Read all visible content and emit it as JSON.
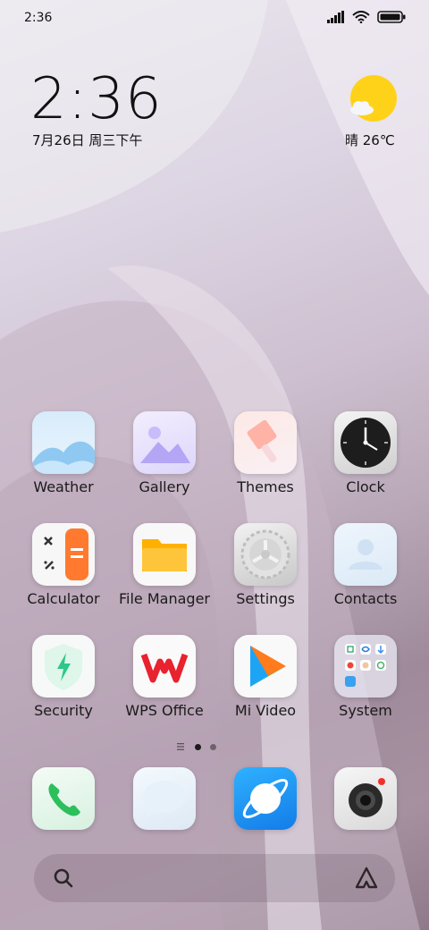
{
  "status_bar": {
    "time": "2:36"
  },
  "clock_widget": {
    "time": "2:36",
    "date": "7月26日 周三下午"
  },
  "weather_widget": {
    "condition_temp": "晴 26℃"
  },
  "apps": [
    {
      "label": "Weather"
    },
    {
      "label": "Gallery"
    },
    {
      "label": "Themes"
    },
    {
      "label": "Clock"
    },
    {
      "label": "Calculator"
    },
    {
      "label": "File Manager"
    },
    {
      "label": "Settings"
    },
    {
      "label": "Contacts"
    },
    {
      "label": "Security"
    },
    {
      "label": "WPS Office"
    },
    {
      "label": "Mi Video"
    },
    {
      "label": "System"
    }
  ],
  "dock": [
    {
      "icon": "phone-icon"
    },
    {
      "icon": "messages-icon"
    },
    {
      "icon": "browser-icon"
    },
    {
      "icon": "camera-icon"
    }
  ],
  "pager": {
    "current_page": 1,
    "page_count": 2
  },
  "colors": {
    "accent_blue": "#1ea4f4",
    "sun_yellow": "#ffd21a",
    "security_green": "#2fc889"
  }
}
